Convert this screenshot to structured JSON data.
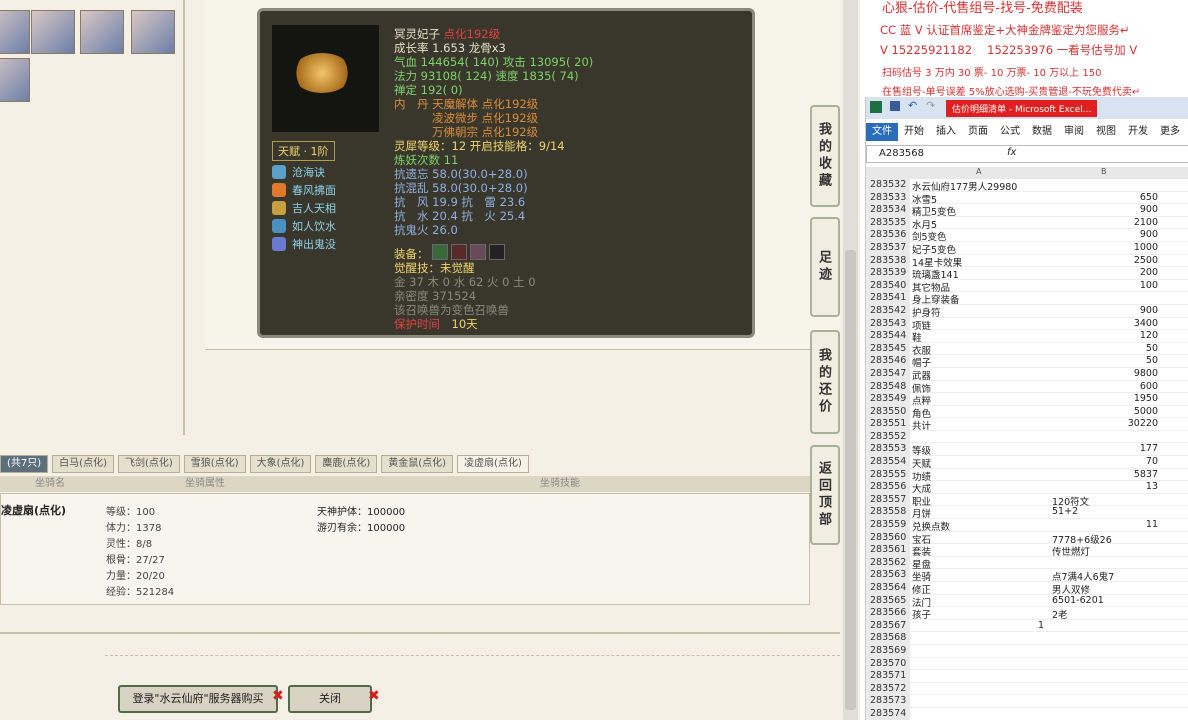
{
  "game": {
    "pet": {
      "name": "冥灵妃子",
      "tag": "点化192级",
      "growth": "成长率 1.653 龙骨x3",
      "hp": "气血 144654( 140) 攻击 13095( 20)",
      "mp": "法力 93108( 124) 速度 1835( 74)",
      "zen": "禅定 192( 0)",
      "nei1": "内　丹 天魔解体 点化192级",
      "nei2": "凌波微步 点化192级",
      "nei3": "万佛朝宗 点化192级",
      "spirit": "灵犀等级：12 开启技能格：9/14",
      "refine": "炼妖次数 11",
      "res1": "抗遗忘 58.0(30.0+28.0)",
      "res2": "抗混乱 58.0(30.0+28.0)",
      "res3": "抗　风 19.9 抗　雷 23.6",
      "res4": "抗　水 20.4 抗　火 25.4",
      "res5": "抗鬼火 26.0",
      "equip": "装备：",
      "awake": "觉醒技：未觉醒",
      "elem": "金 37 木 0 水 62 火 0 土 0",
      "intimacy": "亲密度 371524",
      "note": "该召唤兽为变色召唤兽",
      "protect_label": "保护时间",
      "protect_val": "10天",
      "talent": "天赋 · 1阶",
      "skills": [
        "沧海诀",
        "春风拂面",
        "吉人天相",
        "如人饮水",
        "神出鬼没"
      ]
    },
    "tabs": [
      "(共7只)",
      "白马(点化)",
      "飞剑(点化)",
      "雪狼(点化)",
      "大象(点化)",
      "麋鹿(点化)",
      "黄金鼠(点化)",
      "凌虚扇(点化)"
    ],
    "headers": [
      "坐骑名",
      "坐骑属性",
      "坐骑技能"
    ],
    "mount": {
      "name": "凌虚扇(点化)",
      "stats": [
        "等级：100",
        "体力：1378",
        "灵性：8/8",
        "根骨：27/27",
        "力量：20/20",
        "经验：521284"
      ],
      "skills": [
        "天神护体：100000",
        "游刃有余：100000"
      ]
    },
    "btn_login": "登录\"水云仙府\"服务器购买",
    "btn_close": "关闭",
    "side": [
      "我的收藏",
      "足迹",
      "我的还价",
      "返回顶部"
    ]
  },
  "ad": {
    "l1": "心狠-估价-代售组号-找号-免费配装",
    "l2": "CC 蓝 V 认证首席鉴定+大神金牌鉴定为您服务↵",
    "l3": "V 15225921182　 152253976 一看号估号加 V",
    "l4": "扫码估号 3 万内 30 票- 10 万票- 10 万以上 150",
    "l5": "在售组号-单号误差 5%放心选购-买贵管退-不玩免费代卖↵"
  },
  "excel": {
    "title": "估价明细清单 - Microsoft Excel...",
    "ribbon": [
      "文件",
      "开始",
      "插入",
      "页面",
      "公式",
      "数据",
      "审阅",
      "视图",
      "开发",
      "更多"
    ],
    "ref": "A283568",
    "fx": "fx",
    "col_a": "A",
    "col_b": "B",
    "rows": [
      {
        "n": "283532",
        "a": "水云仙府177男人29980",
        "b": ""
      },
      {
        "n": "283533",
        "a": "冰雪5",
        "b": "650"
      },
      {
        "n": "283534",
        "a": "精卫5变色",
        "b": "900"
      },
      {
        "n": "283535",
        "a": "水月5",
        "b": "2100"
      },
      {
        "n": "283536",
        "a": "剑5变色",
        "b": "900"
      },
      {
        "n": "283537",
        "a": "妃子5变色",
        "b": "1000"
      },
      {
        "n": "283538",
        "a": "14星卡效果",
        "b": "2500"
      },
      {
        "n": "283539",
        "a": "琉璃盏141",
        "b": "200"
      },
      {
        "n": "283540",
        "a": "其它物品",
        "b": "100"
      },
      {
        "n": "283541",
        "a": "身上穿装备",
        "b": ""
      },
      {
        "n": "283542",
        "a": "护身符",
        "b": "900"
      },
      {
        "n": "283543",
        "a": "项链",
        "b": "3400"
      },
      {
        "n": "283544",
        "a": "鞋",
        "b": "120"
      },
      {
        "n": "283545",
        "a": "衣服",
        "b": "50"
      },
      {
        "n": "283546",
        "a": "帽子",
        "b": "50"
      },
      {
        "n": "283547",
        "a": "武器",
        "b": "9800"
      },
      {
        "n": "283548",
        "a": "佩饰",
        "b": "600"
      },
      {
        "n": "283549",
        "a": "点粹",
        "b": "1950"
      },
      {
        "n": "283550",
        "a": "角色",
        "b": "5000"
      },
      {
        "n": "283551",
        "a": "共计",
        "b": "30220"
      },
      {
        "n": "283552",
        "a": "",
        "b": ""
      },
      {
        "n": "283553",
        "a": "等级",
        "b": "177"
      },
      {
        "n": "283554",
        "a": "天赋",
        "b": "70"
      },
      {
        "n": "283555",
        "a": "功绩",
        "b": "5837"
      },
      {
        "n": "283556",
        "a": "大成",
        "b": "13"
      },
      {
        "n": "283557",
        "a": "职业",
        "bl": "120符文"
      },
      {
        "n": "283558",
        "a": "月饼",
        "bl": "51+2"
      },
      {
        "n": "283559",
        "a": "兑换点数",
        "b": "11"
      },
      {
        "n": "283560",
        "a": "宝石",
        "bl": "7778+6级26"
      },
      {
        "n": "283561",
        "a": "套装",
        "bl": "传世燃灯"
      },
      {
        "n": "283562",
        "a": "星盘",
        "b": ""
      },
      {
        "n": "283563",
        "a": "坐骑",
        "bl": "点7满4人6鬼7"
      },
      {
        "n": "283564",
        "a": "修正",
        "bl": "男人双修"
      },
      {
        "n": "283565",
        "a": "法门",
        "bl": "6501-6201"
      },
      {
        "n": "283566",
        "a": "孩子",
        "bl": "2老"
      },
      {
        "n": "283567",
        "a": "",
        "bc": "1"
      },
      {
        "n": "283568",
        "a": "",
        "b": ""
      },
      {
        "n": "283569",
        "a": "",
        "b": ""
      },
      {
        "n": "283570",
        "a": "",
        "b": ""
      },
      {
        "n": "283571",
        "a": "",
        "b": ""
      },
      {
        "n": "283572",
        "a": "",
        "b": ""
      },
      {
        "n": "283573",
        "a": "",
        "b": ""
      },
      {
        "n": "283574",
        "a": "",
        "b": ""
      }
    ]
  }
}
